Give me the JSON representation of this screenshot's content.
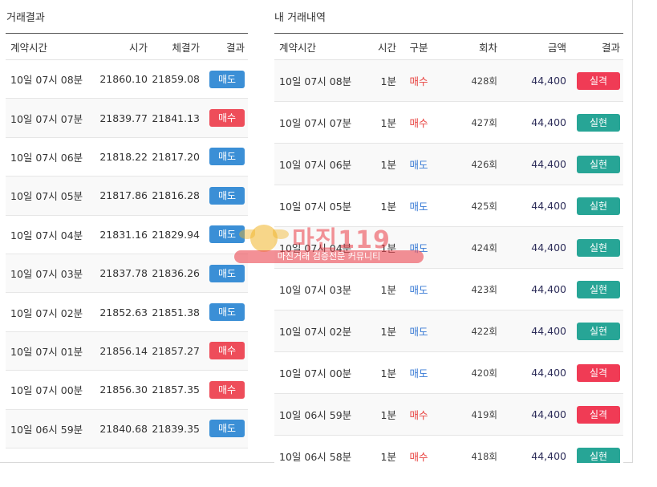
{
  "left_panel": {
    "title": "거래결과",
    "headers": {
      "time": "계약시간",
      "open": "시가",
      "close": "체결가",
      "result": "결과"
    },
    "rows": [
      {
        "time": "10일 07시 08분",
        "open": "21860.10",
        "close": "21859.08",
        "result": "매도",
        "kind": "sell"
      },
      {
        "time": "10일 07시 07분",
        "open": "21839.77",
        "close": "21841.13",
        "result": "매수",
        "kind": "buy"
      },
      {
        "time": "10일 07시 06분",
        "open": "21818.22",
        "close": "21817.20",
        "result": "매도",
        "kind": "sell"
      },
      {
        "time": "10일 07시 05분",
        "open": "21817.86",
        "close": "21816.28",
        "result": "매도",
        "kind": "sell"
      },
      {
        "time": "10일 07시 04분",
        "open": "21831.16",
        "close": "21829.94",
        "result": "매도",
        "kind": "sell"
      },
      {
        "time": "10일 07시 03분",
        "open": "21837.78",
        "close": "21836.26",
        "result": "매도",
        "kind": "sell"
      },
      {
        "time": "10일 07시 02분",
        "open": "21852.63",
        "close": "21851.38",
        "result": "매도",
        "kind": "sell"
      },
      {
        "time": "10일 07시 01분",
        "open": "21856.14",
        "close": "21857.27",
        "result": "매수",
        "kind": "buy"
      },
      {
        "time": "10일 07시 00분",
        "open": "21856.30",
        "close": "21857.35",
        "result": "매수",
        "kind": "buy"
      },
      {
        "time": "10일 06시 59분",
        "open": "21840.68",
        "close": "21839.35",
        "result": "매도",
        "kind": "sell"
      }
    ]
  },
  "right_panel": {
    "title": "내 거래내역",
    "headers": {
      "time": "계약시간",
      "duration": "시간",
      "type": "구분",
      "round": "회차",
      "amount": "금액",
      "result": "결과"
    },
    "rows": [
      {
        "time": "10일 07시 08분",
        "duration": "1분",
        "type": "매수",
        "type_kind": "buy",
        "round": "428회",
        "amount": "44,400",
        "result": "실격",
        "result_kind": "loss"
      },
      {
        "time": "10일 07시 07분",
        "duration": "1분",
        "type": "매수",
        "type_kind": "buy",
        "round": "427회",
        "amount": "44,400",
        "result": "실현",
        "result_kind": "gain"
      },
      {
        "time": "10일 07시 06분",
        "duration": "1분",
        "type": "매도",
        "type_kind": "sell",
        "round": "426회",
        "amount": "44,400",
        "result": "실현",
        "result_kind": "gain"
      },
      {
        "time": "10일 07시 05분",
        "duration": "1분",
        "type": "매도",
        "type_kind": "sell",
        "round": "425회",
        "amount": "44,400",
        "result": "실현",
        "result_kind": "gain"
      },
      {
        "time": "10일 07시 04분",
        "duration": "1분",
        "type": "매도",
        "type_kind": "sell",
        "round": "424회",
        "amount": "44,400",
        "result": "실현",
        "result_kind": "gain"
      },
      {
        "time": "10일 07시 03분",
        "duration": "1분",
        "type": "매도",
        "type_kind": "sell",
        "round": "423회",
        "amount": "44,400",
        "result": "실현",
        "result_kind": "gain"
      },
      {
        "time": "10일 07시 02분",
        "duration": "1분",
        "type": "매도",
        "type_kind": "sell",
        "round": "422회",
        "amount": "44,400",
        "result": "실현",
        "result_kind": "gain"
      },
      {
        "time": "10일 07시 00분",
        "duration": "1분",
        "type": "매도",
        "type_kind": "sell",
        "round": "420회",
        "amount": "44,400",
        "result": "실격",
        "result_kind": "loss"
      },
      {
        "time": "10일 06시 59분",
        "duration": "1분",
        "type": "매수",
        "type_kind": "buy",
        "round": "419회",
        "amount": "44,400",
        "result": "실격",
        "result_kind": "loss"
      },
      {
        "time": "10일 06시 58분",
        "duration": "1분",
        "type": "매수",
        "type_kind": "buy",
        "round": "418회",
        "amount": "44,400",
        "result": "실현",
        "result_kind": "gain"
      }
    ]
  },
  "watermark": {
    "title": "마진119",
    "subtitle": "마진거래 검증전문 커뮤니티",
    "icon": "eagle-emblem-icon"
  },
  "colors": {
    "sell_badge": "#3b8fd6",
    "buy_badge": "#ee4d5a",
    "loss_badge": "#f03b55",
    "gain_badge": "#27a596",
    "buy_text": "#e8423f",
    "sell_text": "#3a7bd5"
  }
}
